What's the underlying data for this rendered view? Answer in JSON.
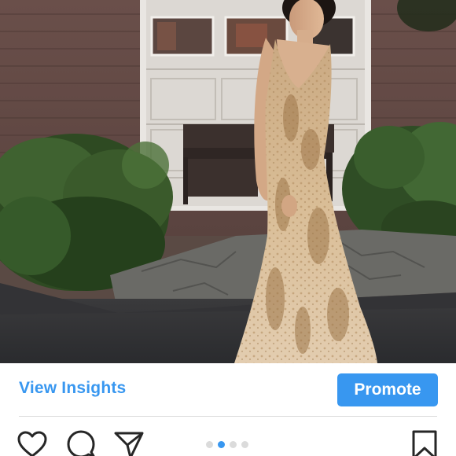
{
  "insights": {
    "view_label": "View Insights",
    "promote_label": "Promote"
  },
  "actions": {
    "like": "heart-icon",
    "comment": "comment-bubble-icon",
    "share": "paper-plane-icon",
    "save": "bookmark-icon"
  },
  "carousel": {
    "count": 4,
    "active_index": 1
  },
  "colors": {
    "accent": "#3897f0",
    "divider": "#dbdbdb",
    "icon": "#262626"
  }
}
